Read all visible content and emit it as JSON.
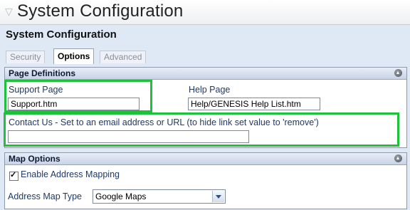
{
  "window": {
    "title": "System Configuration"
  },
  "page": {
    "section_title": "System Configuration"
  },
  "tabs": [
    {
      "label": "Security"
    },
    {
      "label": "Options"
    },
    {
      "label": "Advanced"
    }
  ],
  "page_definitions": {
    "header": "Page Definitions",
    "support_page": {
      "label": "Support Page",
      "value": "Support.htm"
    },
    "help_page": {
      "label": "Help Page",
      "value": "Help/GENESIS Help List.htm"
    },
    "contact_us": {
      "label": "Contact Us - Set to an email address or URL (to hide link set value to 'remove')",
      "value": ""
    }
  },
  "map_options": {
    "header": "Map Options",
    "enable_mapping_label": "Enable Address Mapping",
    "enable_mapping_checked": true,
    "map_type_label": "Address Map Type",
    "map_type_value": "Google Maps"
  },
  "colors": {
    "highlight": "#1ec23a",
    "panel_header": "#c7d3e6",
    "label_text": "#1f3a66"
  },
  "icons": [
    "collapse-triangle-icon",
    "collapse-circle-icon",
    "dropdown-arrow-icon",
    "checkmark-icon"
  ]
}
